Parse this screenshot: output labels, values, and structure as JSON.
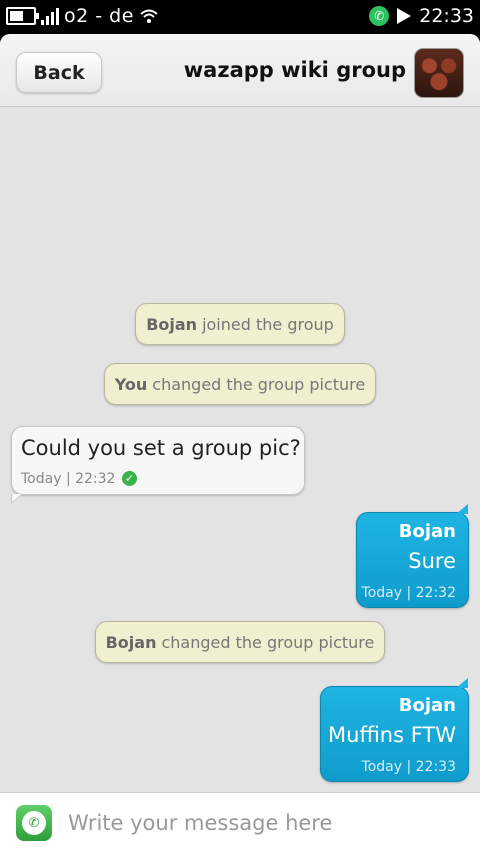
{
  "status_bar": {
    "carrier": "o2 - de",
    "time": "22:33",
    "battery_level": 0.6,
    "signal_bars": 4,
    "icons": [
      "battery-icon",
      "signal-icon",
      "wifi-icon",
      "whatsapp-icon",
      "flag-icon"
    ]
  },
  "header": {
    "back_label": "Back",
    "title": "wazapp wiki group"
  },
  "notices": [
    {
      "actor": "Bojan",
      "action": "joined the group"
    },
    {
      "actor": "You",
      "action": "changed the group picture"
    },
    {
      "actor": "Bojan",
      "action": "changed the group picture"
    }
  ],
  "messages": {
    "incoming": {
      "text": "Could you set a group pic?",
      "timestamp": "Today | 22:32",
      "status": "delivered"
    },
    "outgoing": [
      {
        "sender": "Bojan",
        "text": "Sure",
        "timestamp": "Today | 22:32"
      },
      {
        "sender": "Bojan",
        "text": "Muffins FTW",
        "timestamp": "Today | 22:33"
      }
    ]
  },
  "composer": {
    "placeholder": "Write your message here",
    "value": ""
  },
  "colors": {
    "outgoing_bubble": "#1aa9d8",
    "notice_bubble": "#f0efd0",
    "incoming_bubble": "#f7f7f7",
    "chat_background": "#e3e3e3"
  }
}
